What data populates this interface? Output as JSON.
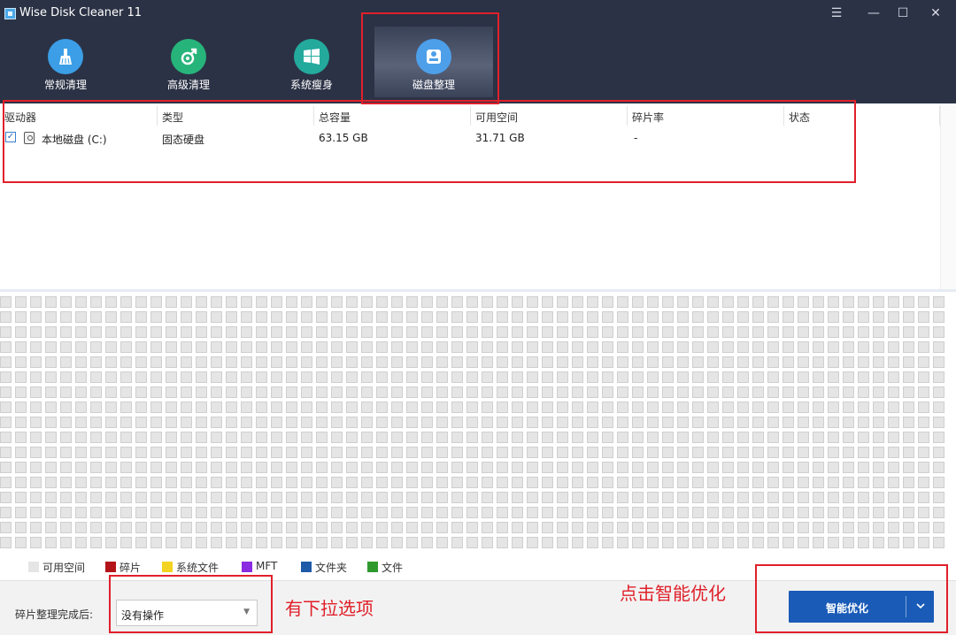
{
  "window": {
    "title": "Wise Disk Cleaner 11",
    "controls": {
      "menu": "☰",
      "minimize": "—",
      "maximize": "☐",
      "close": "✕"
    }
  },
  "tabs": [
    {
      "label": "常规清理",
      "icon": "broom-icon",
      "color": "#3b9ee6"
    },
    {
      "label": "高级清理",
      "icon": "advanced-clean-icon",
      "color": "#27b47b"
    },
    {
      "label": "系统瘦身",
      "icon": "windows-icon",
      "color": "#23aa9d"
    },
    {
      "label": "磁盘整理",
      "icon": "disk-defrag-icon",
      "color": "#4d9fe9",
      "active": true
    }
  ],
  "drive_table": {
    "headers": {
      "drive": "驱动器",
      "type": "类型",
      "capacity": "总容量",
      "free": "可用空间",
      "fragmentation": "碎片率",
      "status": "状态"
    },
    "rows": [
      {
        "checked": true,
        "drive": "本地磁盘 (C:)",
        "type": "固态硬盘",
        "capacity": "63.15 GB",
        "free": "31.71 GB",
        "fragmentation": "-",
        "status": ""
      }
    ]
  },
  "legend": [
    {
      "label": "可用空间",
      "color": "#e5e5e5"
    },
    {
      "label": "碎片",
      "color": "#b3141a"
    },
    {
      "label": "系统文件",
      "color": "#f2d321"
    },
    {
      "label": "MFT",
      "color": "#8a2be2"
    },
    {
      "label": "文件夹",
      "color": "#1e5aa8"
    },
    {
      "label": "文件",
      "color": "#2e9a2e"
    }
  ],
  "bottom": {
    "after_label": "碎片整理完成后:",
    "after_select_value": "没有操作",
    "optimize_label": "智能优化"
  },
  "annotations": {
    "dropdown_note": "有下拉选项",
    "optimize_note": "点击智能优化"
  },
  "colors": {
    "header_bg": "#2b3245",
    "accent": "#1a5bb7",
    "annotation": "#e0202a"
  }
}
